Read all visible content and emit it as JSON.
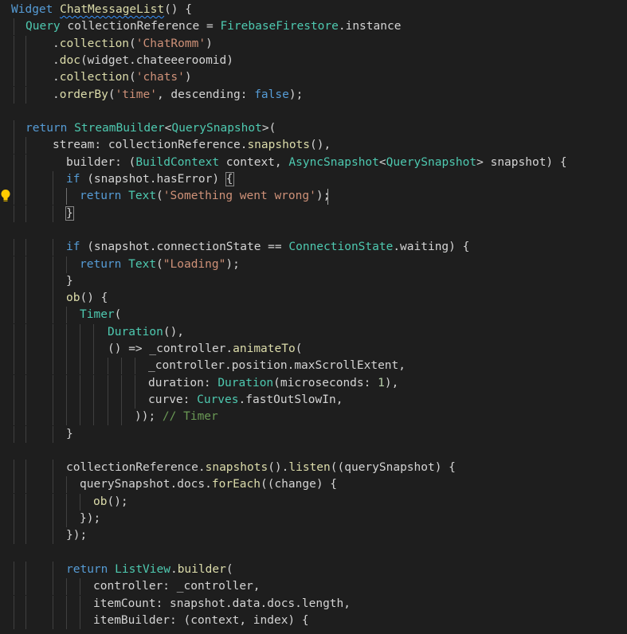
{
  "editor": {
    "lines": [
      [
        {
          "c": "kw",
          "t": "Widget"
        },
        {
          "c": "pl",
          "t": " "
        },
        {
          "c": "fn",
          "t": "ChatMessageList",
          "squig": true
        },
        {
          "c": "pl",
          "t": "() {"
        }
      ],
      [
        {
          "c": "ty",
          "t": "Query"
        },
        {
          "c": "pl",
          "t": " collectionReference = "
        },
        {
          "c": "ty",
          "t": "FirebaseFirestore"
        },
        {
          "c": "pl",
          "t": ".instance"
        }
      ],
      [
        {
          "c": "pl",
          "t": "."
        },
        {
          "c": "fn",
          "t": "collection"
        },
        {
          "c": "pl",
          "t": "("
        },
        {
          "c": "st",
          "t": "'ChatRomm'"
        },
        {
          "c": "pl",
          "t": ")"
        }
      ],
      [
        {
          "c": "pl",
          "t": "."
        },
        {
          "c": "fn",
          "t": "doc"
        },
        {
          "c": "pl",
          "t": "(widget.chateeeroomid)"
        }
      ],
      [
        {
          "c": "pl",
          "t": "."
        },
        {
          "c": "fn",
          "t": "collection"
        },
        {
          "c": "pl",
          "t": "("
        },
        {
          "c": "st",
          "t": "'chats'"
        },
        {
          "c": "pl",
          "t": ")"
        }
      ],
      [
        {
          "c": "pl",
          "t": "."
        },
        {
          "c": "fn",
          "t": "orderBy"
        },
        {
          "c": "pl",
          "t": "("
        },
        {
          "c": "st",
          "t": "'time'"
        },
        {
          "c": "pl",
          "t": ", descending: "
        },
        {
          "c": "kw",
          "t": "false"
        },
        {
          "c": "pl",
          "t": ");"
        }
      ],
      [],
      [
        {
          "c": "kw",
          "t": "return"
        },
        {
          "c": "pl",
          "t": " "
        },
        {
          "c": "ty",
          "t": "StreamBuilder"
        },
        {
          "c": "pl",
          "t": "<"
        },
        {
          "c": "ty",
          "t": "QuerySnapshot"
        },
        {
          "c": "pl",
          "t": ">("
        }
      ],
      [
        {
          "c": "pl",
          "t": "stream: collectionReference."
        },
        {
          "c": "fn",
          "t": "snapshots"
        },
        {
          "c": "pl",
          "t": "(),"
        }
      ],
      [
        {
          "c": "pl",
          "t": "builder: ("
        },
        {
          "c": "ty",
          "t": "BuildContext"
        },
        {
          "c": "pl",
          "t": " context, "
        },
        {
          "c": "ty",
          "t": "AsyncSnapshot"
        },
        {
          "c": "pl",
          "t": "<"
        },
        {
          "c": "ty",
          "t": "QuerySnapshot"
        },
        {
          "c": "pl",
          "t": "> snapshot) {"
        }
      ],
      [
        {
          "c": "kw",
          "t": "if"
        },
        {
          "c": "pl",
          "t": " (snapshot.hasError) "
        },
        {
          "c": "pl",
          "t": "{",
          "brk": true
        }
      ],
      [
        {
          "c": "kw",
          "t": "return"
        },
        {
          "c": "pl",
          "t": " "
        },
        {
          "c": "ty",
          "t": "Text"
        },
        {
          "c": "pl",
          "t": "("
        },
        {
          "c": "st",
          "t": "'Something went wrong'"
        },
        {
          "c": "pl",
          "t": ");"
        }
      ],
      [
        {
          "c": "pl",
          "t": "}",
          "brk": true
        }
      ],
      [],
      [
        {
          "c": "kw",
          "t": "if"
        },
        {
          "c": "pl",
          "t": " (snapshot.connectionState == "
        },
        {
          "c": "ty",
          "t": "ConnectionState"
        },
        {
          "c": "pl",
          "t": ".waiting) {"
        }
      ],
      [
        {
          "c": "kw",
          "t": "return"
        },
        {
          "c": "pl",
          "t": " "
        },
        {
          "c": "ty",
          "t": "Text"
        },
        {
          "c": "pl",
          "t": "("
        },
        {
          "c": "st",
          "t": "\"Loading\""
        },
        {
          "c": "pl",
          "t": ");"
        }
      ],
      [
        {
          "c": "pl",
          "t": "}"
        }
      ],
      [
        {
          "c": "fn",
          "t": "ob"
        },
        {
          "c": "pl",
          "t": "() {"
        }
      ],
      [
        {
          "c": "ty",
          "t": "Timer"
        },
        {
          "c": "pl",
          "t": "("
        }
      ],
      [
        {
          "c": "ty",
          "t": "Duration"
        },
        {
          "c": "pl",
          "t": "(),"
        }
      ],
      [
        {
          "c": "pl",
          "t": "() => _controller."
        },
        {
          "c": "fn",
          "t": "animateTo"
        },
        {
          "c": "pl",
          "t": "("
        }
      ],
      [
        {
          "c": "pl",
          "t": "_controller.position.maxScrollExtent,"
        }
      ],
      [
        {
          "c": "pl",
          "t": "duration: "
        },
        {
          "c": "ty",
          "t": "Duration"
        },
        {
          "c": "pl",
          "t": "(microseconds: "
        },
        {
          "c": "nm",
          "t": "1"
        },
        {
          "c": "pl",
          "t": "),"
        }
      ],
      [
        {
          "c": "pl",
          "t": "curve: "
        },
        {
          "c": "ty",
          "t": "Curves"
        },
        {
          "c": "pl",
          "t": ".fastOutSlowIn,"
        }
      ],
      [
        {
          "c": "pl",
          "t": ")); "
        },
        {
          "c": "cm",
          "t": "// Timer"
        }
      ],
      [
        {
          "c": "pl",
          "t": "}"
        }
      ],
      [],
      [
        {
          "c": "pl",
          "t": "collectionReference."
        },
        {
          "c": "fn",
          "t": "snapshots"
        },
        {
          "c": "pl",
          "t": "()."
        },
        {
          "c": "fn",
          "t": "listen"
        },
        {
          "c": "pl",
          "t": "((querySnapshot) {"
        }
      ],
      [
        {
          "c": "pl",
          "t": "querySnapshot.docs."
        },
        {
          "c": "fn",
          "t": "forEach"
        },
        {
          "c": "pl",
          "t": "((change) {"
        }
      ],
      [
        {
          "c": "fn",
          "t": "ob"
        },
        {
          "c": "pl",
          "t": "();"
        }
      ],
      [
        {
          "c": "pl",
          "t": "});"
        }
      ],
      [
        {
          "c": "pl",
          "t": "});"
        }
      ],
      [],
      [
        {
          "c": "kw",
          "t": "return"
        },
        {
          "c": "pl",
          "t": " "
        },
        {
          "c": "ty",
          "t": "ListView"
        },
        {
          "c": "pl",
          "t": "."
        },
        {
          "c": "fn",
          "t": "builder"
        },
        {
          "c": "pl",
          "t": "("
        }
      ],
      [
        {
          "c": "pl",
          "t": "controller: _controller,"
        }
      ],
      [
        {
          "c": "pl",
          "t": "itemCount: snapshot.data.docs.length,"
        }
      ],
      [
        {
          "c": "pl",
          "t": "itemBuilder: (context, index) {"
        }
      ]
    ]
  },
  "colors": {
    "background": "#1e1e1e",
    "keyword": "#569cd6",
    "type": "#4ec9b0",
    "function": "#dcdcaa",
    "string": "#ce9178",
    "number": "#b5cea8",
    "comment": "#6a9955",
    "plain": "#d4d4d4",
    "lightbulb": "#ffcc00"
  },
  "icons": {
    "lightbulb": "lightbulb-icon"
  }
}
